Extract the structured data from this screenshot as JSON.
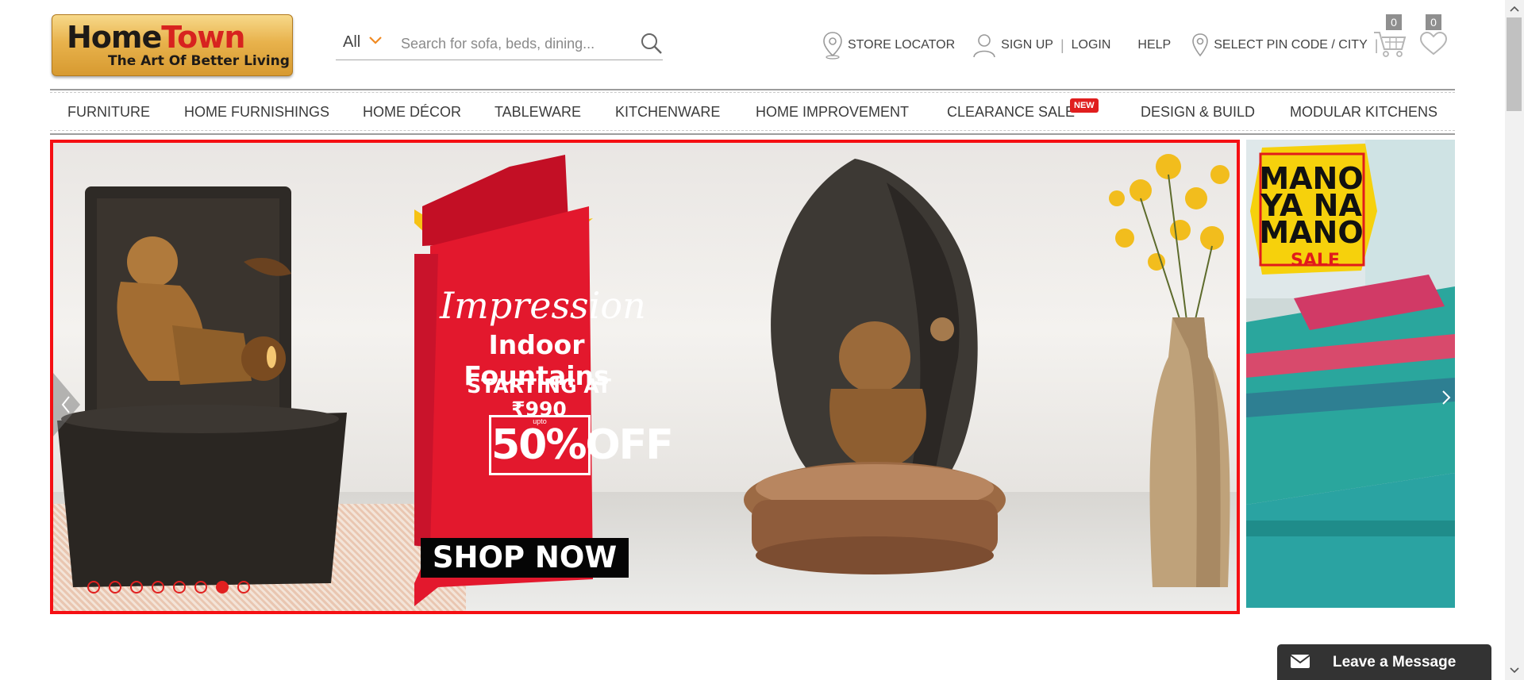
{
  "logo": {
    "brand_part1": "Home",
    "brand_part2": "Town",
    "tagline": "The Art Of Better Living"
  },
  "search": {
    "category": "All",
    "placeholder": "Search for sofa, beds, dining..."
  },
  "top_links": {
    "store_locator": "STORE LOCATOR",
    "sign_up": "SIGN UP",
    "separator": "|",
    "login": "LOGIN",
    "help": "HELP",
    "pin_code": "SELECT PIN CODE / CITY"
  },
  "cart": {
    "count": "0"
  },
  "wishlist": {
    "count": "0"
  },
  "nav": {
    "items": [
      {
        "label": "FURNITURE"
      },
      {
        "label": "HOME FURNISHINGS"
      },
      {
        "label": "HOME DÉCOR"
      },
      {
        "label": "TABLEWARE"
      },
      {
        "label": "KITCHENWARE"
      },
      {
        "label": "HOME IMPROVEMENT"
      },
      {
        "label": "CLEARANCE SALE"
      },
      {
        "label": "DESIGN & BUILD"
      },
      {
        "label": "MODULAR KITCHENS"
      }
    ],
    "new_badge": "NEW"
  },
  "banner": {
    "title": "Impression",
    "subtitle": "Indoor Fountains",
    "starting": "STARTING AT ₹990",
    "off_prefix": "upto",
    "off": "50%OFF",
    "cta": "SHOP NOW",
    "dots_total": 8,
    "active_dot": 7
  },
  "side_banner": {
    "line1": "MANO",
    "line2": "YA NA",
    "line3": "MANO",
    "sale": "SALE"
  },
  "chat": {
    "label": "Leave a Message"
  },
  "colors": {
    "accent_red": "#f50f13",
    "orange": "#f08a21",
    "chat_bg": "#333333"
  }
}
